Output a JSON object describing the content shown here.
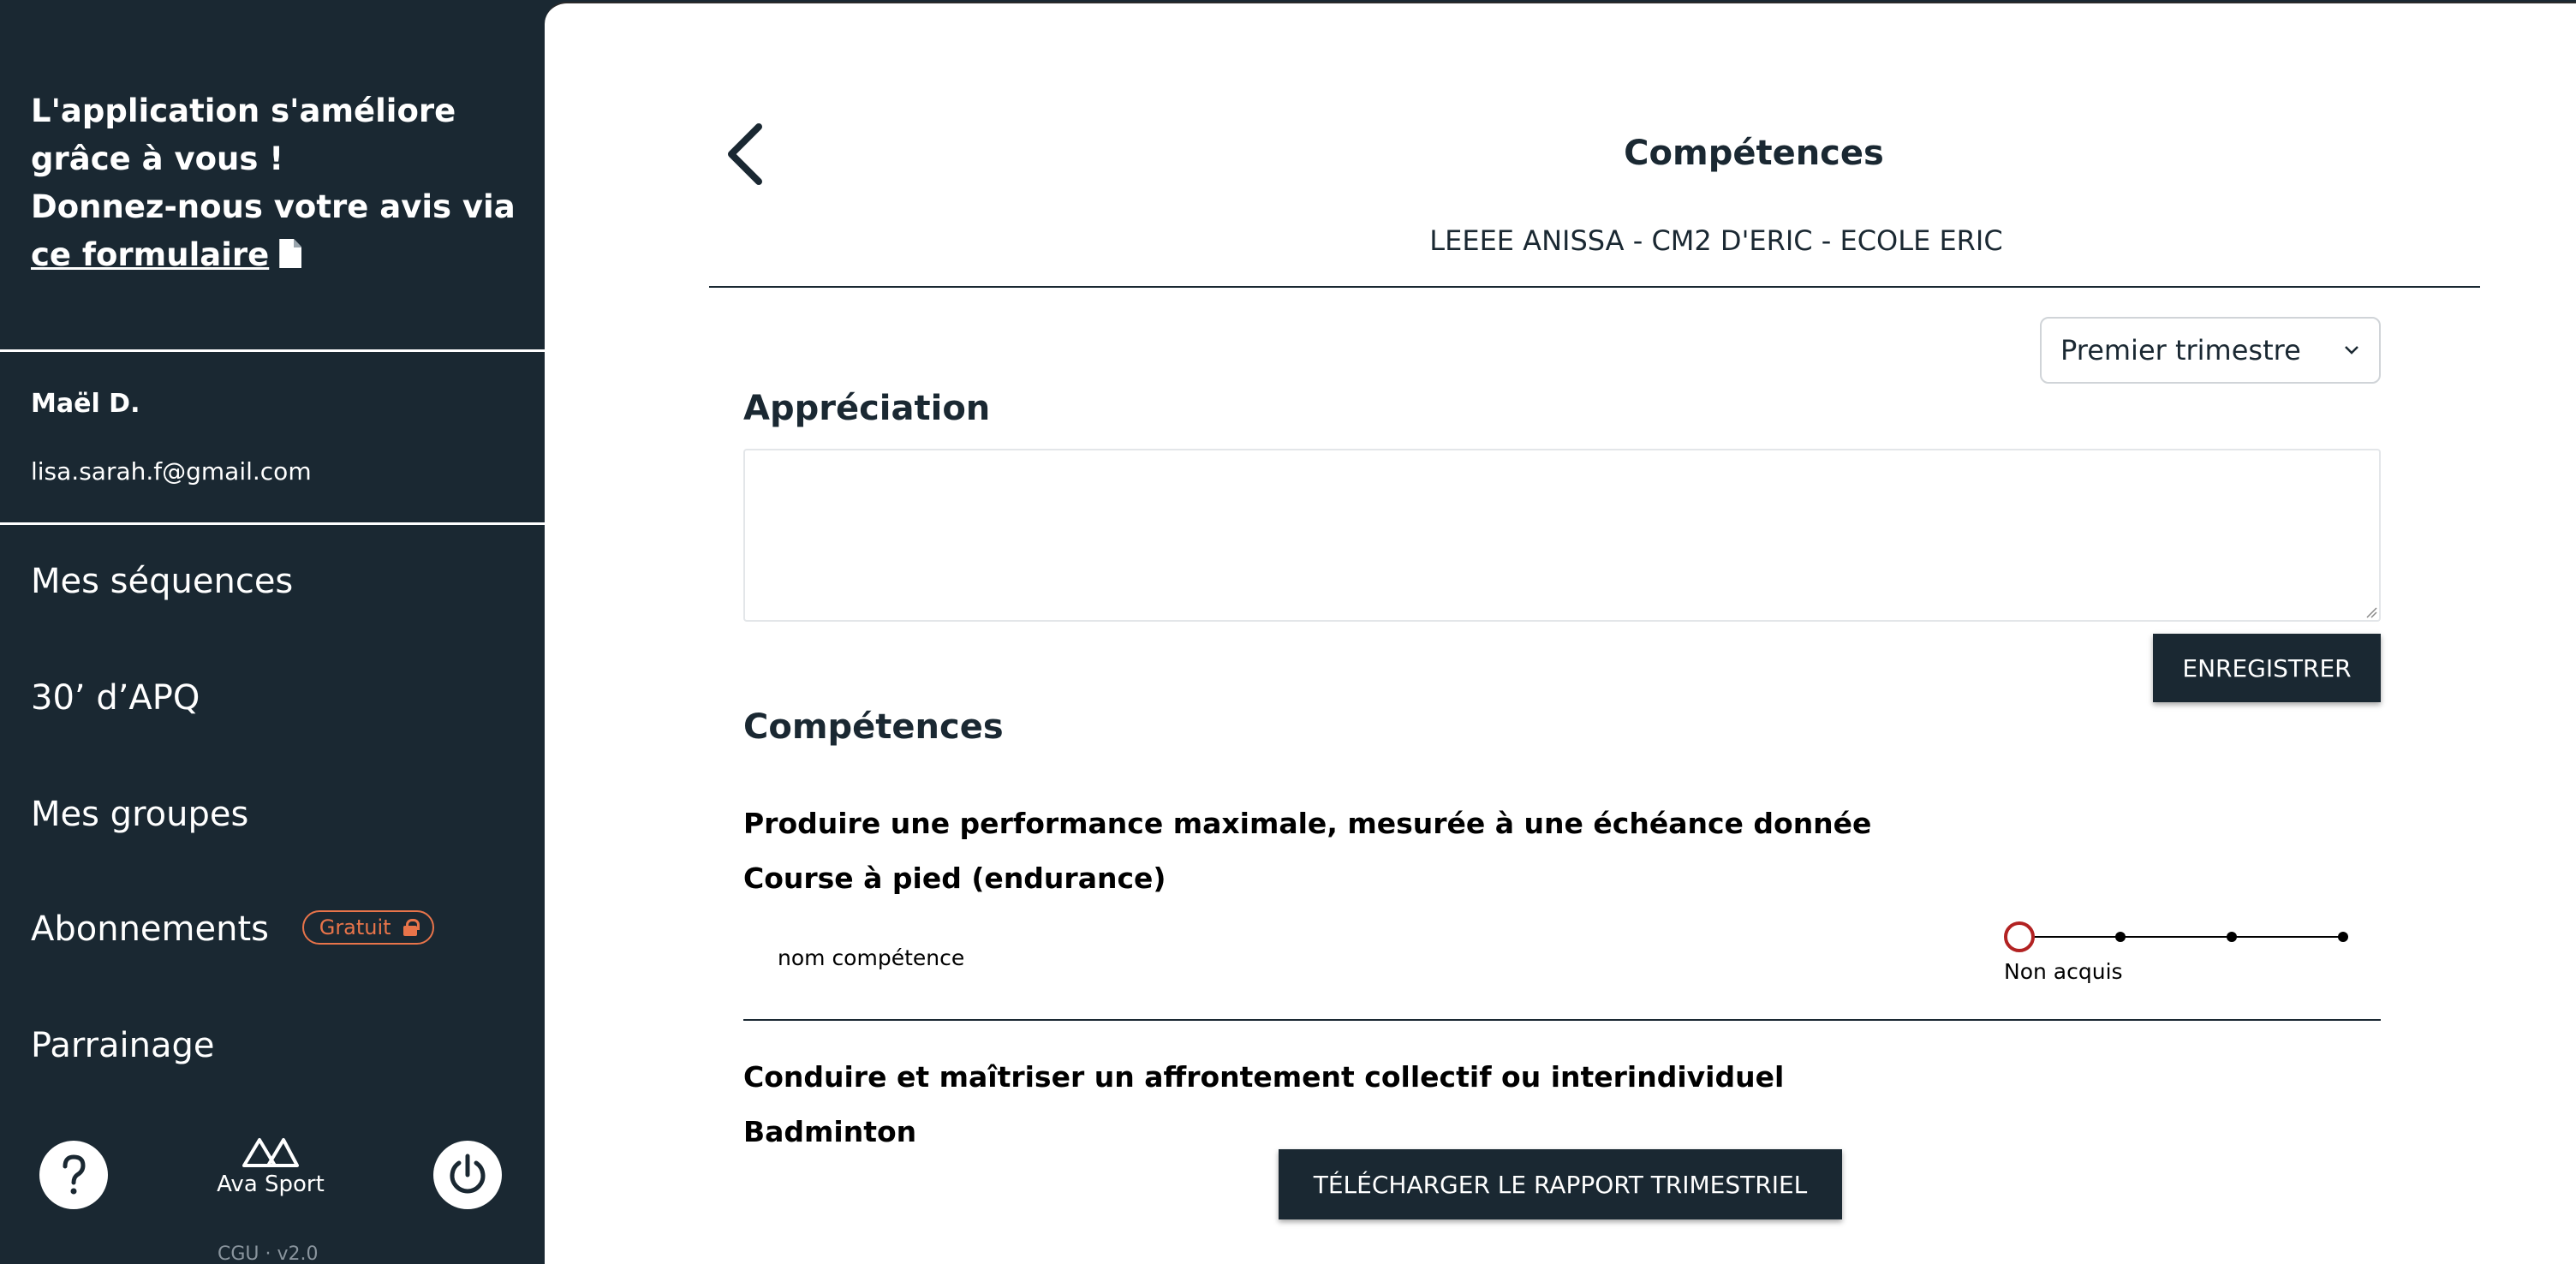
{
  "sidebar": {
    "feedback": {
      "line1": "L'application s'améliore",
      "line2": "grâce à vous !",
      "line3": "Donnez-nous votre avis via",
      "link": "ce formulaire"
    },
    "user": {
      "name": "Maël D.",
      "email": "lisa.sarah.f@gmail.com"
    },
    "nav": [
      {
        "label": "Mes séquences"
      },
      {
        "label": "30’ d’APQ"
      },
      {
        "label": "Mes groupes"
      },
      {
        "label": "Abonnements",
        "badge": "Gratuit"
      },
      {
        "label": "Parrainage"
      }
    ],
    "logo_text": "Ava Sport",
    "footer_links": "CGU · v2.0",
    "icons": [
      "help-icon",
      "power-icon",
      "lock-icon",
      "document-icon"
    ]
  },
  "header": {
    "title": "Compétences",
    "student": "LEEEE ANISSA - CM2 D'ERIC - ECOLE ERIC"
  },
  "period_select": {
    "value": "Premier trimestre"
  },
  "appreciation": {
    "title": "Appréciation",
    "value": "",
    "save_label": "ENREGISTRER"
  },
  "competences": {
    "title": "Compétences",
    "groups": [
      {
        "goal": "Produire une performance maximale, mesurée à une échéance donnée",
        "activity": "Course à pied (endurance)",
        "skills": [
          {
            "name": "nom compétence",
            "level_label": "Non acquis",
            "level": 1,
            "levels_total": 4
          }
        ]
      },
      {
        "goal": "Conduire et maîtriser un affrontement collectif ou interindividuel",
        "activity": "Badminton"
      }
    ]
  },
  "download_label": "TÉLÉCHARGER LE RAPPORT TRIMESTRIEL",
  "colors": {
    "sidebar_bg": "#1a2832",
    "accent_orange": "#e8744a",
    "level_red": "#b22222"
  }
}
